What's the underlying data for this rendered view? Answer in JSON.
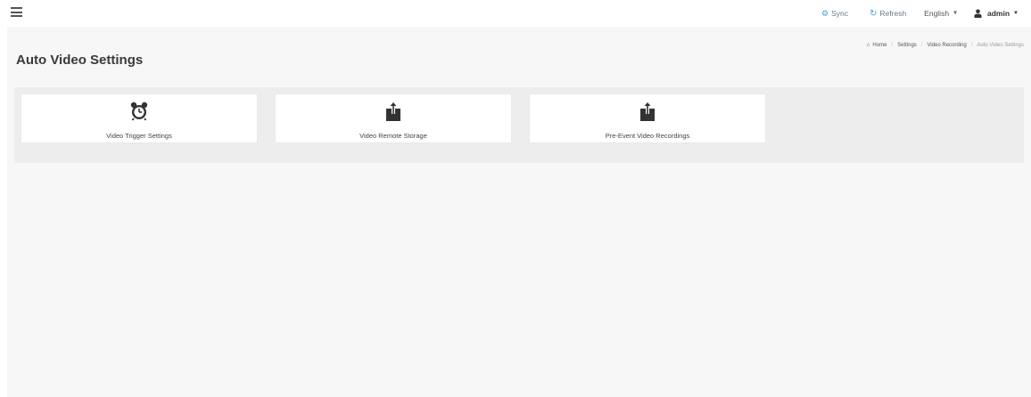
{
  "topbar": {
    "sync_label": "Sync",
    "refresh_label": "Refresh",
    "language_label": "English",
    "user_label": "admin"
  },
  "page": {
    "title": "Auto Video Settings"
  },
  "breadcrumb": {
    "home": "Home",
    "items": [
      "Settings",
      "Video Recording",
      "Auto Video Settings"
    ]
  },
  "tiles": [
    {
      "label": "Video Trigger Settings",
      "icon": "alarm-clock-icon"
    },
    {
      "label": "Video Remote Storage",
      "icon": "upload-box-icon"
    },
    {
      "label": "Pre-Event Video Recordings",
      "icon": "upload-box-icon"
    }
  ],
  "colors": {
    "accent": "#3b9fd8",
    "background": "#f7f7f7",
    "panel": "#ededed",
    "icon": "#333333"
  }
}
